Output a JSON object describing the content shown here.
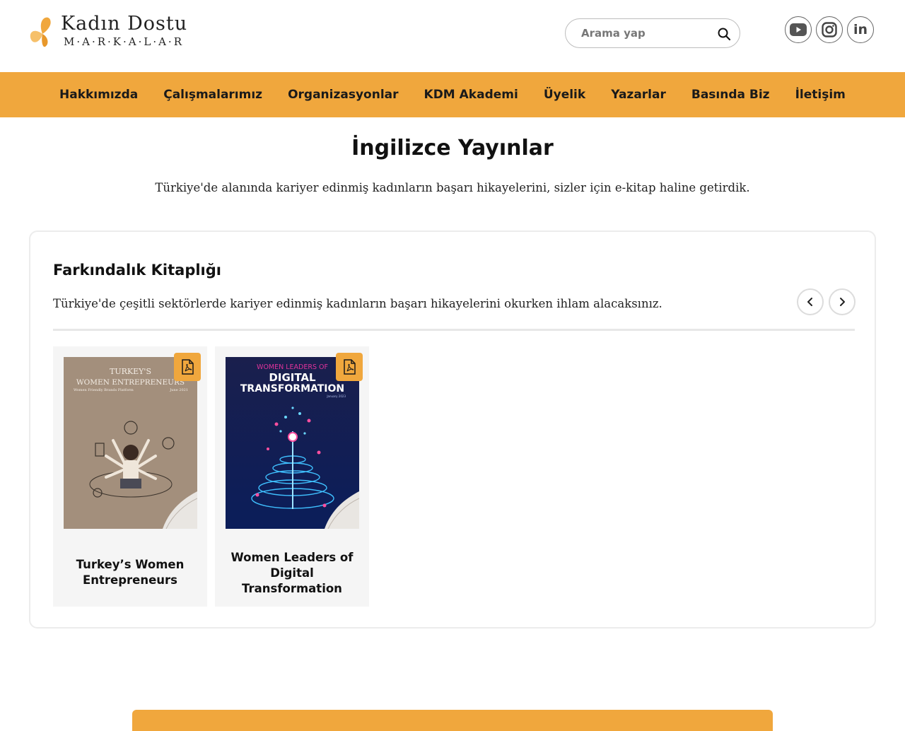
{
  "header": {
    "logo": {
      "line1": "Kadın Dostu",
      "line2": "M·A·R·K·A·L·A·R"
    },
    "search": {
      "placeholder": "Arama yap",
      "icon": "search-icon"
    },
    "socials": [
      {
        "name": "youtube",
        "icon": "youtube-icon"
      },
      {
        "name": "instagram",
        "icon": "instagram-icon"
      },
      {
        "name": "linkedin",
        "icon": "linkedin-icon",
        "text": "in"
      }
    ]
  },
  "nav": {
    "items": [
      "Hakkımızda",
      "Çalışmalarımız",
      "Organizasyonlar",
      "KDM Akademi",
      "Üyelik",
      "Yazarlar",
      "Basında Biz",
      "İletişim"
    ]
  },
  "page": {
    "title": "İngilizce Yayınlar",
    "subtitle": "Türkiye'de alanında kariyer edinmiş kadınların başarı hikayelerini, sizler için e-kitap haline getirdik."
  },
  "library": {
    "title": "Farkındalık Kitaplığı",
    "subtitle": "Türkiye'de çeşitli sektörlerde kariyer edinmiş kadınların başarı hikayelerini okurken ihlam alacaksınız.",
    "books": [
      {
        "title": "Turkey’s Women Entrepreneurs",
        "cover": {
          "heading1": "TURKEY'S",
          "heading2": "WOMEN ENTREPRENEURS",
          "tagline": "Women Friendly Brands Platform",
          "date": "June 2021"
        }
      },
      {
        "title": "Women Leaders of Digital Transformation",
        "cover": {
          "heading1": "WOMEN LEADERS OF",
          "heading2": "DIGITAL",
          "heading3": "TRANSFORMATION",
          "date": "January 2023"
        }
      }
    ]
  },
  "colors": {
    "accent": "#f0a73d",
    "text": "#111111",
    "card_bg": "#f5f5f5"
  }
}
